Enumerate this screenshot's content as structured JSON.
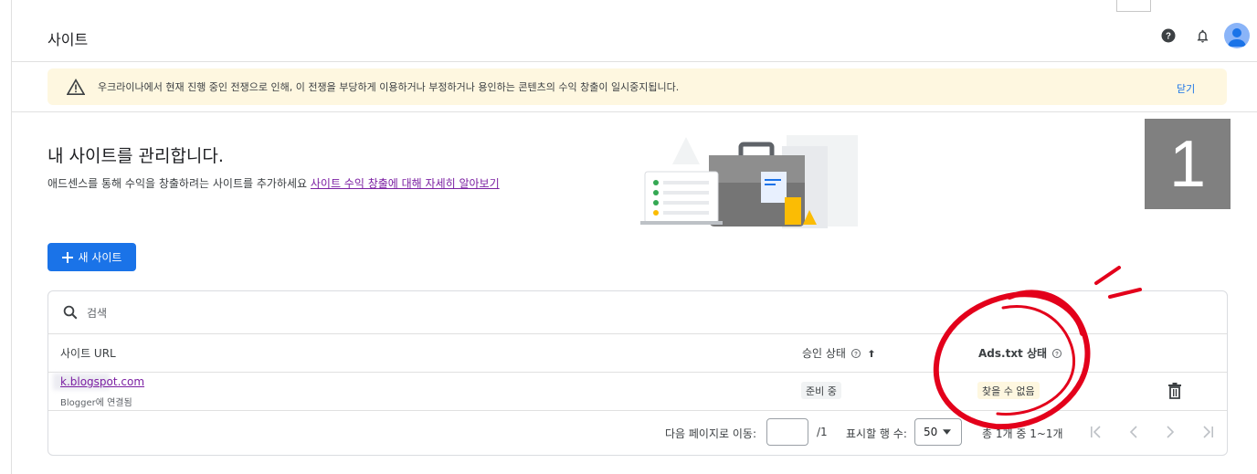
{
  "header": {
    "title": "사이트",
    "help_icon": "help-circle-icon",
    "bell_icon": "bell-icon",
    "avatar_icon": "account-avatar-icon"
  },
  "banner": {
    "text": "우크라이나에서 현재 진행 중인 전쟁으로 인해, 이 전쟁을 부당하게 이용하거나 부정하거나 용인하는 콘텐츠의 수익 창출이 일시중지됩니다.",
    "close_label": "닫기",
    "icon": "warning-icon"
  },
  "hero": {
    "title": "내 사이트를 관리합니다.",
    "subtitle": "애드센스를 통해 수익을 창출하려는 사이트를 추가하세요",
    "link_text": "사이트 수익 창출에 대해 자세히 알아보기"
  },
  "badge": {
    "label": "1"
  },
  "new_site_button": {
    "label": "새 사이트",
    "icon": "plus-icon"
  },
  "search": {
    "placeholder": "검색"
  },
  "table": {
    "columns": [
      {
        "label": "사이트 URL"
      },
      {
        "label": "승인 상태"
      },
      {
        "label": "Ads.txt 상태"
      }
    ],
    "rows": [
      {
        "url": "k.blogspot.com",
        "sub": "Blogger에 연결됨",
        "approval": "준비 중",
        "ads_txt": "찾을 수 없음"
      }
    ]
  },
  "pagination": {
    "goto_label": "다음 페이지로 이동:",
    "page_total": "/1",
    "rows_label": "표시할 행 수:",
    "rows_value": "50",
    "range_text": "총 1개 중 1~1개"
  },
  "colors": {
    "accent": "#1a73e8",
    "banner_bg": "#fef7e0",
    "link_visited": "#7b1fa2",
    "annotation": "#e3001b"
  }
}
